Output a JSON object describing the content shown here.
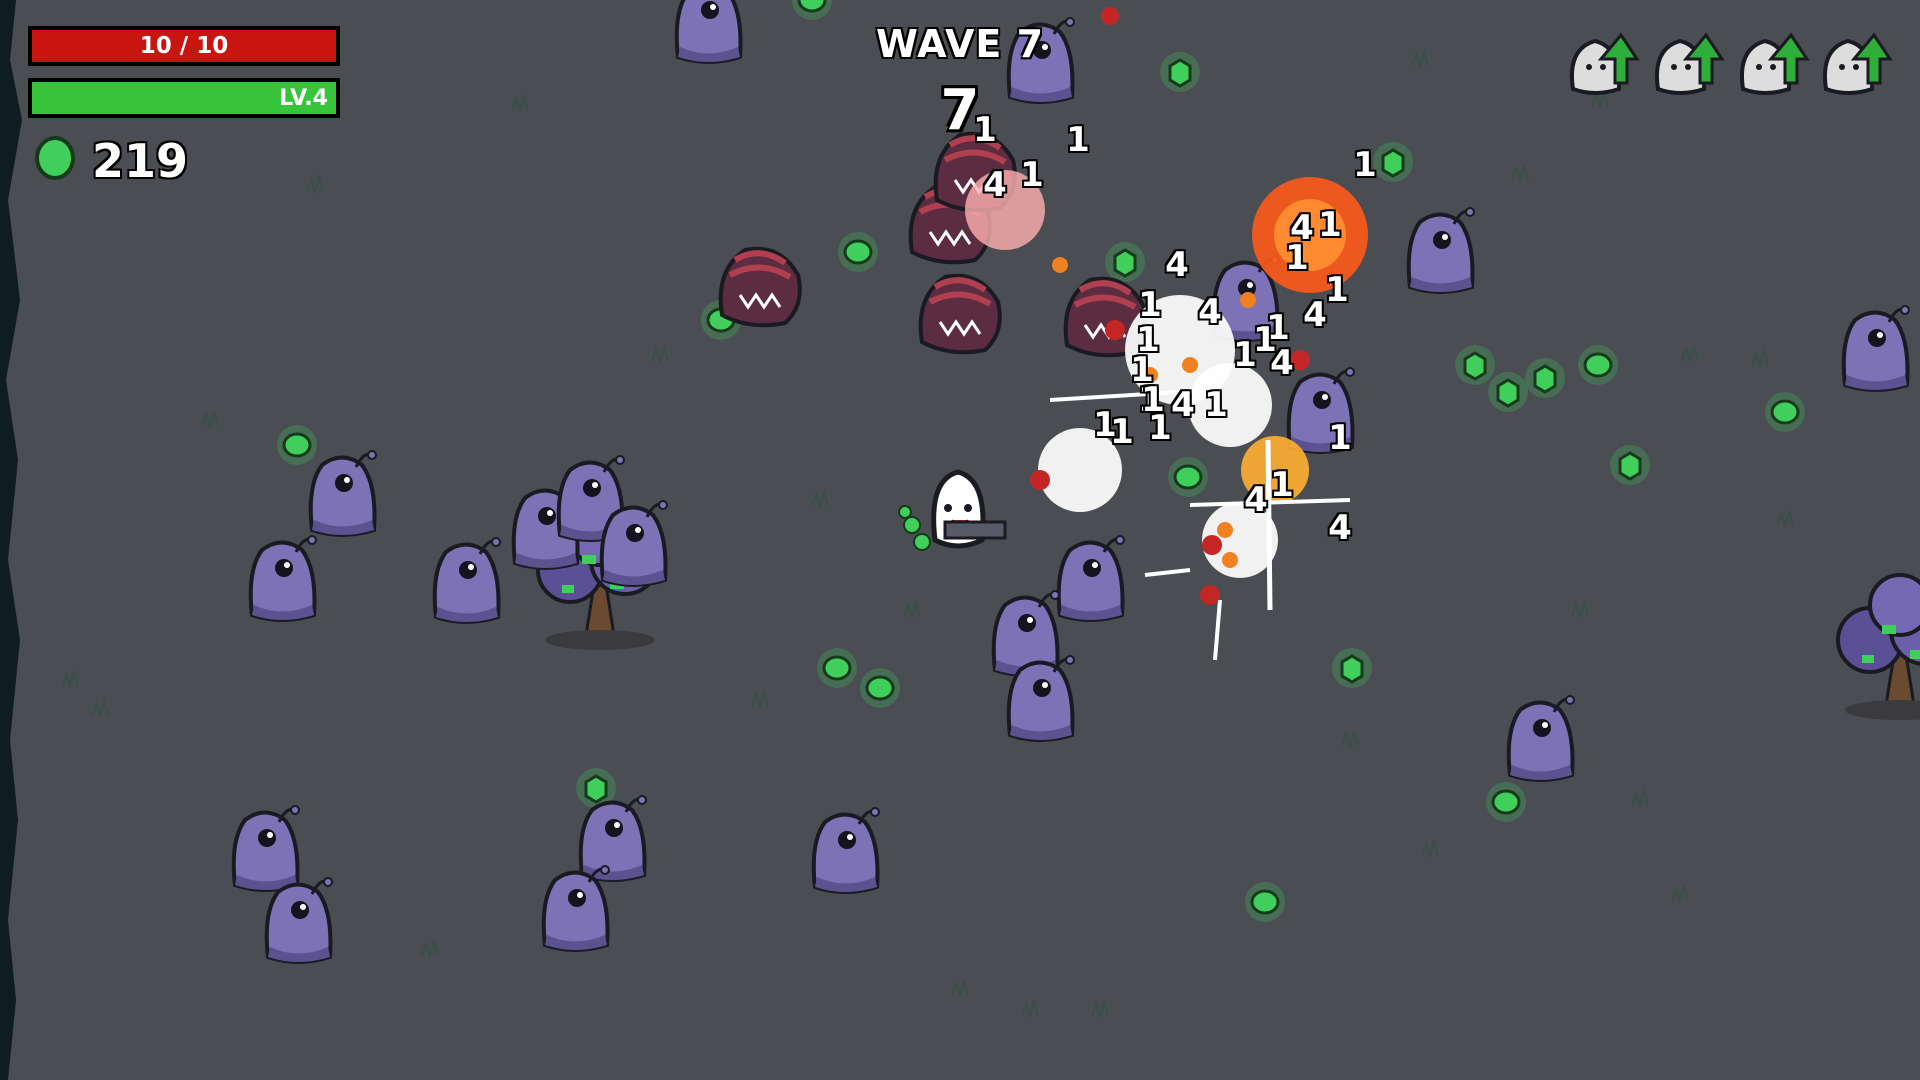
{
  "hud": {
    "health_text": "10 / 10",
    "health_fraction": 1.0,
    "level_text": "LV.4",
    "xp_fraction": 1.0,
    "materials": "219",
    "wave_label": "WAVE 7",
    "wave_timer": "7",
    "pending_upgrades": 4
  },
  "damage_numbers": [
    "1",
    "1",
    "1",
    "4",
    "1",
    "1",
    "4",
    "1",
    "1",
    "4",
    "1",
    "1",
    "1",
    "4",
    "1",
    "4",
    "1",
    "4",
    "1",
    "1",
    "1",
    "1",
    "1",
    "1",
    "4",
    "1",
    "4",
    "1",
    "4",
    "1"
  ],
  "colors": {
    "background": "#4a4d52",
    "health": "#c8150f",
    "xp": "#35c43a",
    "enemy": "#7d72b5",
    "material": "#3fcf5a"
  },
  "icons": {
    "material": "material-icon",
    "upgrade": "upgrade-arrow-icon",
    "player": "potato-character"
  }
}
